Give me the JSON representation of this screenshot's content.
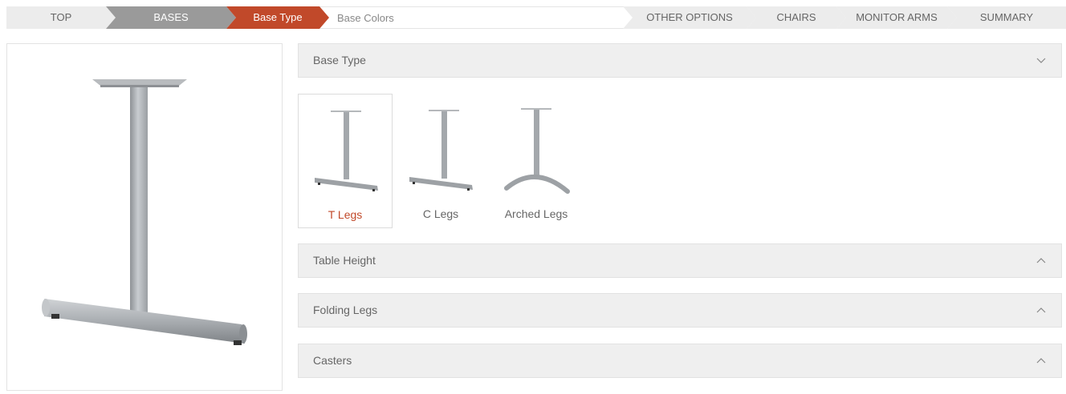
{
  "breadcrumb": {
    "top": "TOP",
    "bases": "BASES",
    "base_type": "Base Type",
    "base_colors": "Base Colors",
    "other_options": "OTHER OPTIONS",
    "chairs": "CHAIRS",
    "monitor_arms": "MONITOR ARMS",
    "summary": "SUMMARY"
  },
  "colors": {
    "accent": "#c1492a",
    "active_step": "#9a9a9a",
    "panel": "#efefef"
  },
  "sections": {
    "base_type": {
      "title": "Base Type",
      "state": "expanded"
    },
    "table_height": {
      "title": "Table Height",
      "state": "collapsed"
    },
    "folding_legs": {
      "title": "Folding Legs",
      "state": "collapsed"
    },
    "casters": {
      "title": "Casters",
      "state": "collapsed"
    }
  },
  "options": [
    {
      "label": "T Legs",
      "selected": true,
      "icon": "t-leg-icon"
    },
    {
      "label": "C Legs",
      "selected": false,
      "icon": "c-leg-icon"
    },
    {
      "label": "Arched Legs",
      "selected": false,
      "icon": "arched-leg-icon"
    }
  ]
}
